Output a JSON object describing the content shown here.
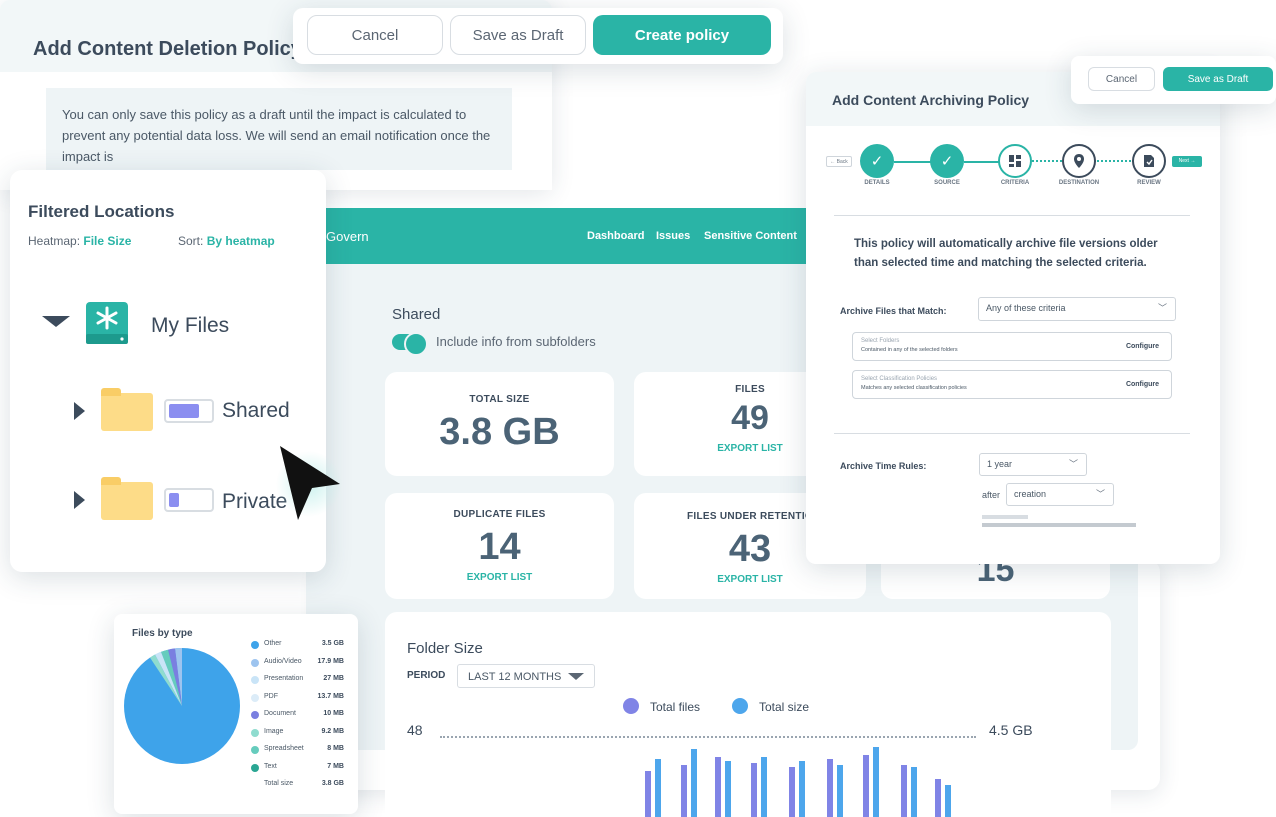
{
  "deletion_policy": {
    "title": "Add Content Deletion Policy",
    "notice": "You can only save this policy as a draft until the impact is calculated to prevent any potential data loss. We will send an email notification once the impact is",
    "actions": {
      "cancel": "Cancel",
      "save_draft": "Save as Draft",
      "create": "Create policy"
    }
  },
  "dashboard": {
    "brand": "Govern",
    "nav": [
      "Dashboard",
      "Issues",
      "Sensitive Content"
    ],
    "section": "Shared",
    "toggle_label": "Include info from subfolders",
    "stats": [
      {
        "label": "TOTAL SIZE",
        "value": "3.8 GB",
        "export": ""
      },
      {
        "label": "FILES",
        "value": "49",
        "export": "EXPORT LIST"
      },
      {
        "label": "DUPLICATE FILES",
        "value": "14",
        "export": "EXPORT LIST"
      },
      {
        "label": "FILES UNDER RETENTIO",
        "value": "43",
        "export": "EXPORT LIST"
      },
      {
        "label": "",
        "value": "15",
        "export": ""
      }
    ],
    "folder_size": {
      "title": "Folder Size",
      "period_label": "PERIOD",
      "period_value": "LAST 12 MONTHS",
      "legend": [
        "Total files",
        "Total size"
      ],
      "left_axis": "48",
      "right_axis": "4.5 GB",
      "colors": {
        "files": "#8084e6",
        "size": "#4da6ec"
      }
    }
  },
  "locations": {
    "title": "Filtered Locations",
    "heatmap_label": "Heatmap:",
    "heatmap_value": "File Size",
    "sort_label": "Sort:",
    "sort_value": "By heatmap",
    "root": "My Files",
    "children": [
      {
        "name": "Shared",
        "fill": 0.75
      },
      {
        "name": "Private",
        "fill": 0.25
      }
    ]
  },
  "archive_policy": {
    "title": "Add Content Archiving Policy",
    "actions": {
      "cancel": "Cancel",
      "save_draft": "Save as Draft"
    },
    "back": "← Back",
    "next": "Next →",
    "steps": [
      "DETAILS",
      "SOURCE",
      "CRITERIA",
      "DESTINATION",
      "REVIEW"
    ],
    "description": "This policy will automatically archive file versions older than selected time and matching the selected criteria.",
    "match_label": "Archive Files that Match:",
    "match_value": "Any of these criteria",
    "folders": {
      "title": "Select Folders",
      "sub": "Contained in any of the selected folders",
      "action": "Configure"
    },
    "classification": {
      "title": "Select Classification Policies",
      "sub": "Matches any selected classification policies",
      "action": "Configure"
    },
    "time_label": "Archive Time Rules:",
    "time_value": "1 year",
    "after_label": "after",
    "after_value": "creation"
  },
  "files_by_type": {
    "title": "Files by type",
    "rows": [
      {
        "name": "Other",
        "value": "3.5 GB",
        "color": "#3ea3ea"
      },
      {
        "name": "Audio/Video",
        "value": "17.9 MB",
        "color": "#9dc4ef"
      },
      {
        "name": "Presentation",
        "value": "27 MB",
        "color": "#c9e4f7"
      },
      {
        "name": "PDF",
        "value": "13.7 MB",
        "color": "#dcecf8"
      },
      {
        "name": "Document",
        "value": "10 MB",
        "color": "#7a7fe0"
      },
      {
        "name": "Image",
        "value": "9.2 MB",
        "color": "#8fdccf"
      },
      {
        "name": "Spreadsheet",
        "value": "8 MB",
        "color": "#66ccbd"
      },
      {
        "name": "Text",
        "value": "7 MB",
        "color": "#2aa693"
      },
      {
        "name": "Total size",
        "value": "3.8 GB",
        "color": ""
      }
    ]
  }
}
